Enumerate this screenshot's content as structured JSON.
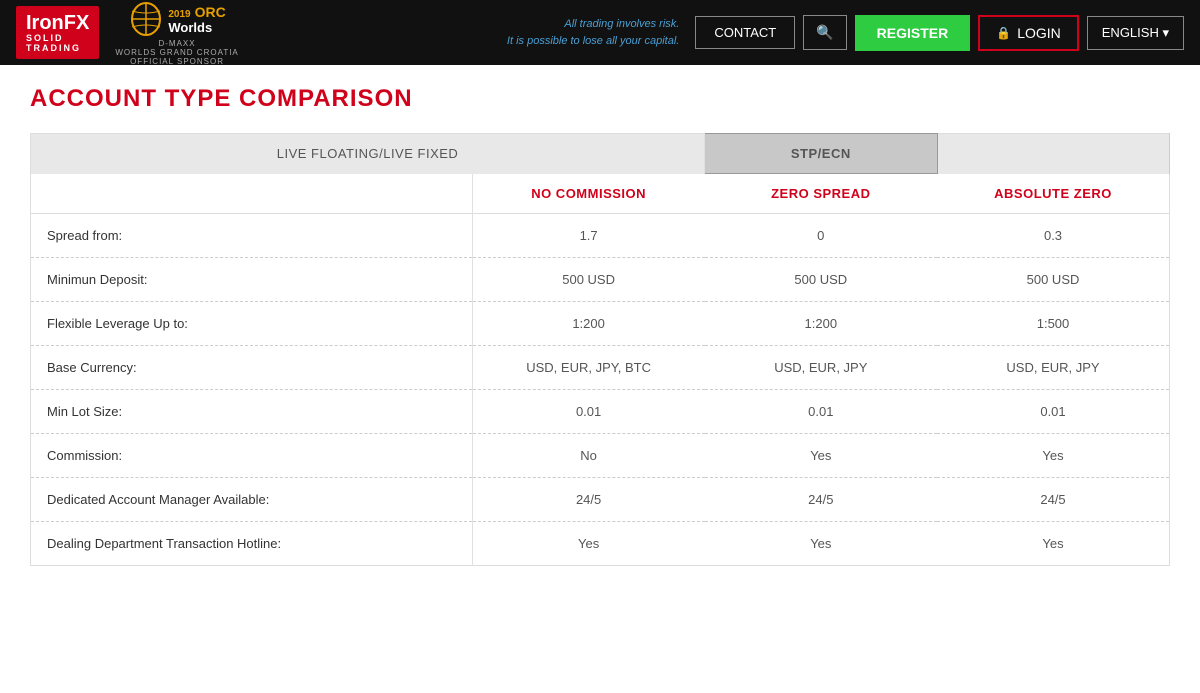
{
  "header": {
    "logo": {
      "brand": "IronFX",
      "solid": "SOLID",
      "trading": "TRADING"
    },
    "sponsor": {
      "year": "2019",
      "label": "ORC",
      "worlds": "Worlds",
      "sub1": "D-MAXX",
      "sub2": "WORLDS GRAND CROATIA",
      "official": "OFFICIAL SPONSOR"
    },
    "nav": {
      "contact": "CONTACT",
      "search_icon": "🔍",
      "register": "REGISTER",
      "login": "LOGIN",
      "lock_icon": "🔒",
      "language": "ENGLISH"
    },
    "risk_line1": "All trading involves risk.",
    "risk_line2": "It is possible to lose all your capital."
  },
  "page": {
    "title": "ACCOUNT TYPE COMPARISON"
  },
  "table": {
    "tab_live": "LIVE FLOATING/LIVE FIXED",
    "tab_stp": "STP/ECN",
    "col_label": "",
    "col_no_commission": "NO COMMISSION",
    "col_zero_spread": "ZERO SPREAD",
    "col_absolute_zero": "ABSOLUTE ZERO",
    "rows": [
      {
        "label": "Spread from:",
        "no_commission": "1.7",
        "zero_spread": "0",
        "absolute_zero": "0.3"
      },
      {
        "label": "Minimun Deposit:",
        "no_commission": "500 USD",
        "zero_spread": "500 USD",
        "absolute_zero": "500 USD"
      },
      {
        "label": "Flexible Leverage Up to:",
        "no_commission": "1:200",
        "zero_spread": "1:200",
        "absolute_zero": "1:500"
      },
      {
        "label": "Base Currency:",
        "no_commission": "USD, EUR, JPY, BTC",
        "zero_spread": "USD, EUR, JPY",
        "absolute_zero": "USD, EUR, JPY"
      },
      {
        "label": "Min Lot Size:",
        "no_commission": "0.01",
        "zero_spread": "0.01",
        "absolute_zero": "0.01"
      },
      {
        "label": "Commission:",
        "no_commission": "No",
        "zero_spread": "Yes",
        "absolute_zero": "Yes"
      },
      {
        "label": "Dedicated Account Manager Available:",
        "no_commission": "24/5",
        "zero_spread": "24/5",
        "absolute_zero": "24/5"
      },
      {
        "label": "Dealing Department Transaction Hotline:",
        "no_commission": "Yes",
        "zero_spread": "Yes",
        "absolute_zero": "Yes"
      }
    ]
  }
}
